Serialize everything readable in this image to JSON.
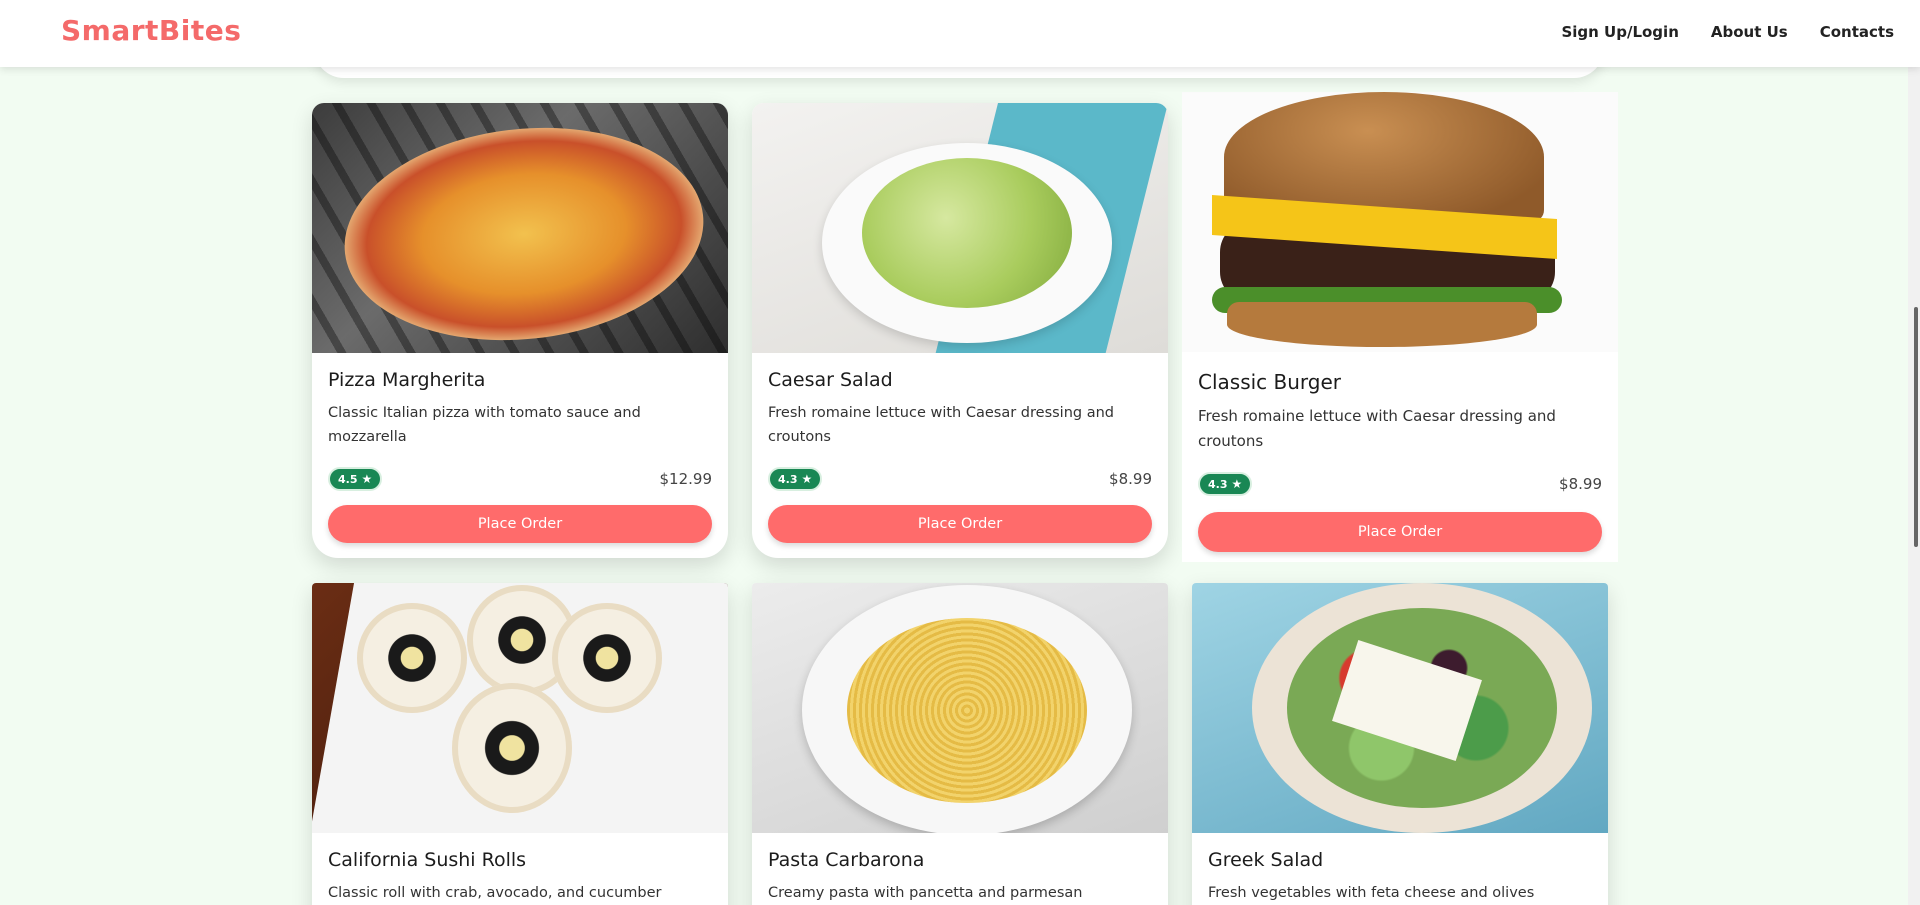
{
  "header": {
    "brand": "SmartBites",
    "nav": [
      "Sign Up/Login",
      "About Us",
      "Contacts"
    ]
  },
  "colors": {
    "brand": "#f46a6a",
    "button": "#ff6b6b",
    "rating_badge": "#198754",
    "page_bg": "#f2fcf2"
  },
  "cards": [
    {
      "title": "Pizza Margherita",
      "desc": "Classic Italian pizza with tomato sauce and mozzarella",
      "rating": "4.5",
      "price": "$12.99",
      "button": "Place Order"
    },
    {
      "title": "Caesar Salad",
      "desc": "Fresh romaine lettuce with Caesar dressing and croutons",
      "rating": "4.3",
      "price": "$8.99",
      "button": "Place Order"
    },
    {
      "title": "Classic Burger",
      "desc": "Fresh romaine lettuce with Caesar dressing and croutons",
      "rating": "4.3",
      "price": "$8.99",
      "button": "Place Order"
    },
    {
      "title": "California Sushi Rolls",
      "desc": "Classic roll with crab, avocado, and cucumber"
    },
    {
      "title": "Pasta Carbarona",
      "desc": "Creamy pasta with pancetta and parmesan"
    },
    {
      "title": "Greek Salad",
      "desc": "Fresh vegetables with feta cheese and olives"
    }
  ]
}
